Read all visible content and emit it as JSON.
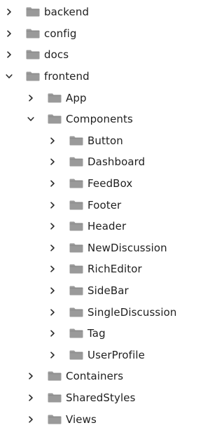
{
  "colors": {
    "folder_body": "#9a9a9a",
    "folder_tab": "#8a8a8a",
    "chevron": "#2b2b2b",
    "text": "#1f1f1f"
  },
  "icons": {
    "collapsed": "chevron-right-icon",
    "expanded": "chevron-down-icon",
    "folder": "folder-icon"
  },
  "tree": [
    {
      "label": "backend",
      "level": 0,
      "expanded": false
    },
    {
      "label": "config",
      "level": 0,
      "expanded": false
    },
    {
      "label": "docs",
      "level": 0,
      "expanded": false
    },
    {
      "label": "frontend",
      "level": 0,
      "expanded": true
    },
    {
      "label": "App",
      "level": 1,
      "expanded": false
    },
    {
      "label": "Components",
      "level": 1,
      "expanded": true
    },
    {
      "label": "Button",
      "level": 2,
      "expanded": false
    },
    {
      "label": "Dashboard",
      "level": 2,
      "expanded": false
    },
    {
      "label": "FeedBox",
      "level": 2,
      "expanded": false
    },
    {
      "label": "Footer",
      "level": 2,
      "expanded": false
    },
    {
      "label": "Header",
      "level": 2,
      "expanded": false
    },
    {
      "label": "NewDiscussion",
      "level": 2,
      "expanded": false
    },
    {
      "label": "RichEditor",
      "level": 2,
      "expanded": false
    },
    {
      "label": "SideBar",
      "level": 2,
      "expanded": false
    },
    {
      "label": "SingleDiscussion",
      "level": 2,
      "expanded": false
    },
    {
      "label": "Tag",
      "level": 2,
      "expanded": false
    },
    {
      "label": "UserProfile",
      "level": 2,
      "expanded": false
    },
    {
      "label": "Containers",
      "level": 1,
      "expanded": false
    },
    {
      "label": "SharedStyles",
      "level": 1,
      "expanded": false
    },
    {
      "label": "Views",
      "level": 1,
      "expanded": false
    }
  ]
}
